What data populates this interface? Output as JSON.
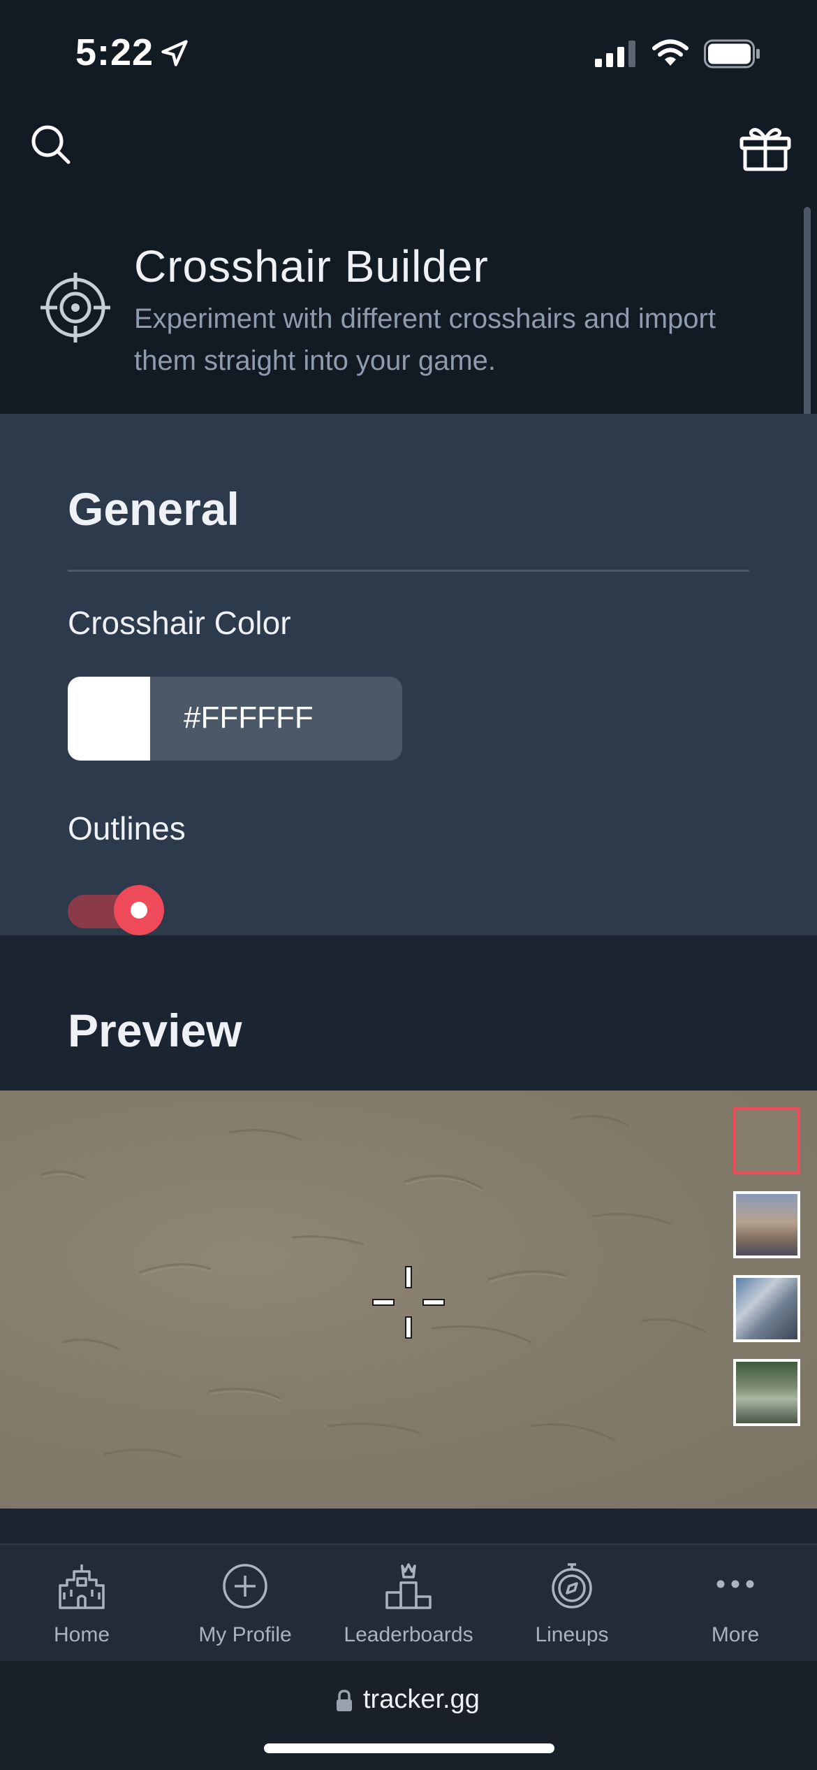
{
  "status_bar": {
    "time": "5:22"
  },
  "header": {
    "title": "Crosshair Builder",
    "subtitle": "Experiment with different crosshairs and import them straight into your game."
  },
  "general": {
    "title": "General",
    "color_label": "Crosshair Color",
    "color_value": "#FFFFFF",
    "outlines_label": "Outlines",
    "outlines_on": true
  },
  "preview": {
    "title": "Preview",
    "maps": [
      "plain",
      "map-1",
      "map-2",
      "map-3"
    ],
    "selected_map": 0
  },
  "nav": {
    "items": [
      {
        "label": "Home",
        "icon": "castle-icon"
      },
      {
        "label": "My Profile",
        "icon": "plus-circle-icon"
      },
      {
        "label": "Leaderboards",
        "icon": "podium-icon"
      },
      {
        "label": "Lineups",
        "icon": "compass-icon"
      },
      {
        "label": "More",
        "icon": "more-dots-icon"
      }
    ]
  },
  "browser": {
    "url": "tracker.gg"
  },
  "colors": {
    "accent": "#EF4A5A",
    "background": "#121A24",
    "panel": "#2C3A4B"
  }
}
